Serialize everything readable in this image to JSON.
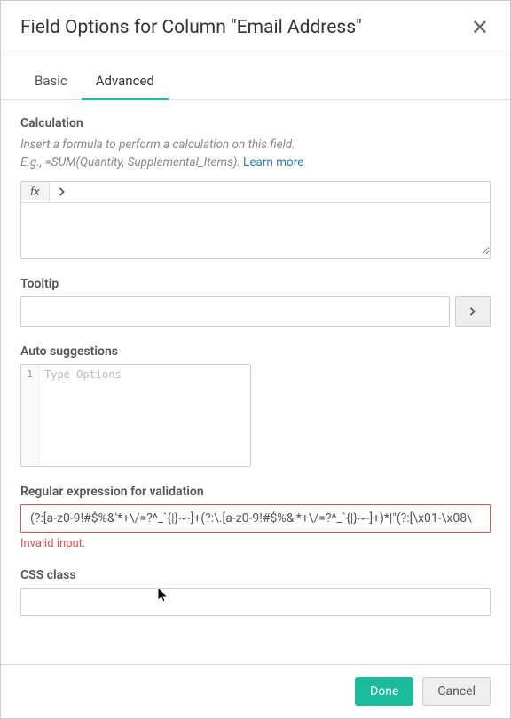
{
  "dialog": {
    "title": "Field Options for Column \"Email Address\""
  },
  "tabs": {
    "basic": "Basic",
    "advanced": "Advanced"
  },
  "calculation": {
    "label": "Calculation",
    "hint1": "Insert a formula to perform a calculation on this field.",
    "hint2": "E.g., =SUM(Quantity, Supplemental_Items). ",
    "learn_more": "Learn more",
    "fx_label": "fx",
    "value": ""
  },
  "tooltip": {
    "label": "Tooltip",
    "value": ""
  },
  "suggestions": {
    "label": "Auto suggestions",
    "line_no": "1",
    "placeholder": "Type Options"
  },
  "regex": {
    "label": "Regular expression for validation",
    "value": "(?:[a-z0-9!#$%&'*+\\/=?^_`{|}~-]+(?:\\.[a-z0-9!#$%&'*+\\/=?^_`{|}~-]+)*|\"(?:[\\x01-\\x08\\",
    "error": "Invalid input."
  },
  "css": {
    "label": "CSS class",
    "value": ""
  },
  "footer": {
    "done": "Done",
    "cancel": "Cancel"
  }
}
